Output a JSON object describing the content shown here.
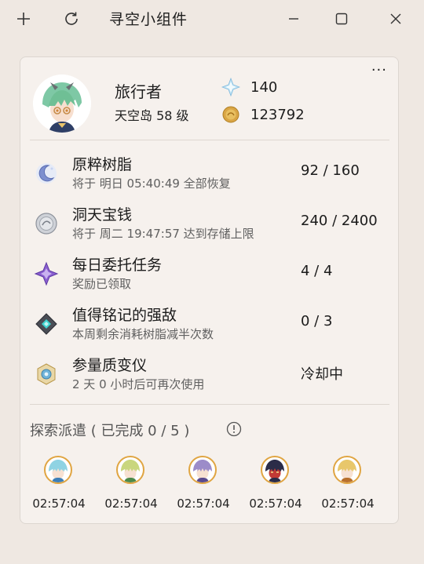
{
  "window": {
    "title": "寻空小组件",
    "buttons": [
      "add-icon",
      "refresh-icon",
      "minimize-icon",
      "maximize-icon",
      "close-icon"
    ]
  },
  "profile": {
    "name": "旅行者",
    "level": "天空岛 58 级",
    "primogems": "140",
    "mora": "123792"
  },
  "menu": {
    "more_label": "···"
  },
  "notes": [
    {
      "title": "原粹树脂",
      "subtitle": "将于 明日 05:40:49 全部恢复",
      "value": "92 / 160",
      "icon": "resin-moon-icon"
    },
    {
      "title": "洞天宝钱",
      "subtitle": "将于 周二 19:47:57 达到存储上限",
      "value": "240 / 2400",
      "icon": "realm-coin-icon"
    },
    {
      "title": "每日委托任务",
      "subtitle": "奖励已领取",
      "value": "4 / 4",
      "icon": "commission-icon"
    },
    {
      "title": "值得铭记的强敌",
      "subtitle": "本周剩余消耗树脂减半次数",
      "value": "0 / 3",
      "icon": "weekly-boss-icon"
    },
    {
      "title": "参量质变仪",
      "subtitle": "2 天 0 小时后可再次使用",
      "value": "冷却中",
      "icon": "transformer-icon"
    }
  ],
  "expedition": {
    "header": "探索派遣 ( 已完成 0 / 5 )",
    "items": [
      {
        "time": "02:57:04",
        "hair": "#8fd3e3",
        "accent": "#3e7fb7"
      },
      {
        "time": "02:57:04",
        "hair": "#c9d67e",
        "accent": "#4d8a4a"
      },
      {
        "time": "02:57:04",
        "hair": "#9c8cc9",
        "accent": "#5a4a8e"
      },
      {
        "time": "02:57:04",
        "hair": "#2b2c48",
        "accent": "#c23a35"
      },
      {
        "time": "02:57:04",
        "hair": "#e8c76b",
        "accent": "#b86f2c"
      }
    ]
  },
  "colors": {
    "background": "#efe8e2",
    "card": "#f6f1ed",
    "accent_orange": "#e0a542"
  }
}
